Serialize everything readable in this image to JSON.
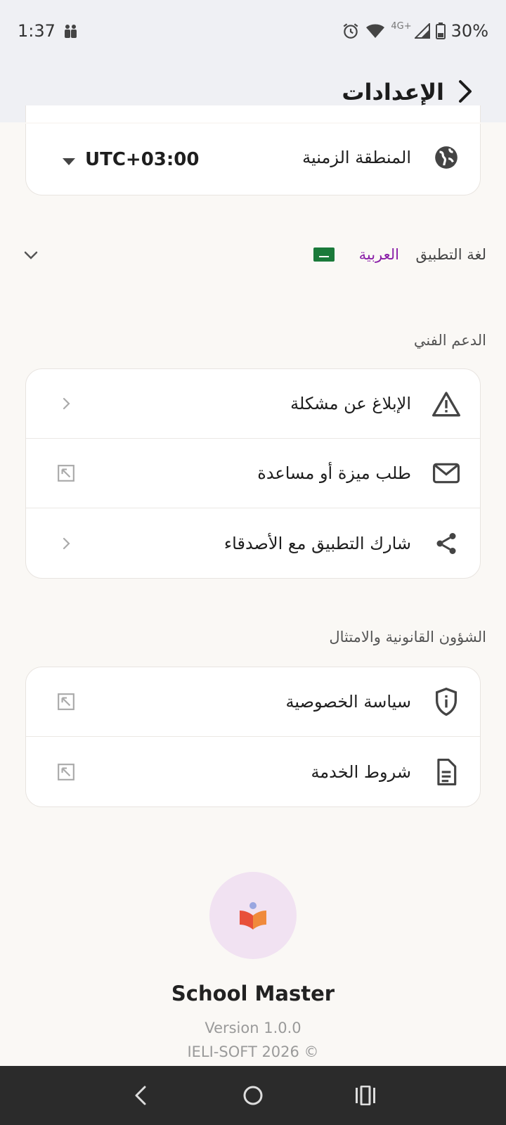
{
  "status_bar": {
    "time": "1:37",
    "network": "4G+",
    "battery": "30%"
  },
  "app_bar": {
    "title": "الإعدادات"
  },
  "timezone": {
    "label": "المنطقة الزمنية",
    "value": "UTC+03:00",
    "icon": "globe-icon"
  },
  "language": {
    "label": "لغة التطبيق",
    "value": "العربية",
    "flag": "saudi-flag"
  },
  "support": {
    "section_title": "الدعم الفني",
    "items": [
      {
        "label": "الإبلاغ عن مشكلة",
        "icon": "warning-icon",
        "trailing": "chevron-right-icon"
      },
      {
        "label": "طلب ميزة أو مساعدة",
        "icon": "mail-icon",
        "trailing": "external-link-icon"
      },
      {
        "label": "شارك التطبيق مع الأصدقاء",
        "icon": "share-icon",
        "trailing": "chevron-right-icon"
      }
    ]
  },
  "legal": {
    "section_title": "الشؤون القانونية والامتثال",
    "items": [
      {
        "label": "سياسة الخصوصية",
        "icon": "shield-info-icon",
        "trailing": "external-link-icon"
      },
      {
        "label": "شروط الخدمة",
        "icon": "document-icon",
        "trailing": "external-link-icon"
      }
    ]
  },
  "footer": {
    "app_name": "School Master",
    "version": "Version 1.0.0",
    "copyright": "IELI-SOFT 2026 ©"
  },
  "colors": {
    "accent_purple": "#8a1fa8",
    "background": "#faf8f5",
    "app_bar": "#eff0f4",
    "logo_bg": "#f1e2f2"
  }
}
